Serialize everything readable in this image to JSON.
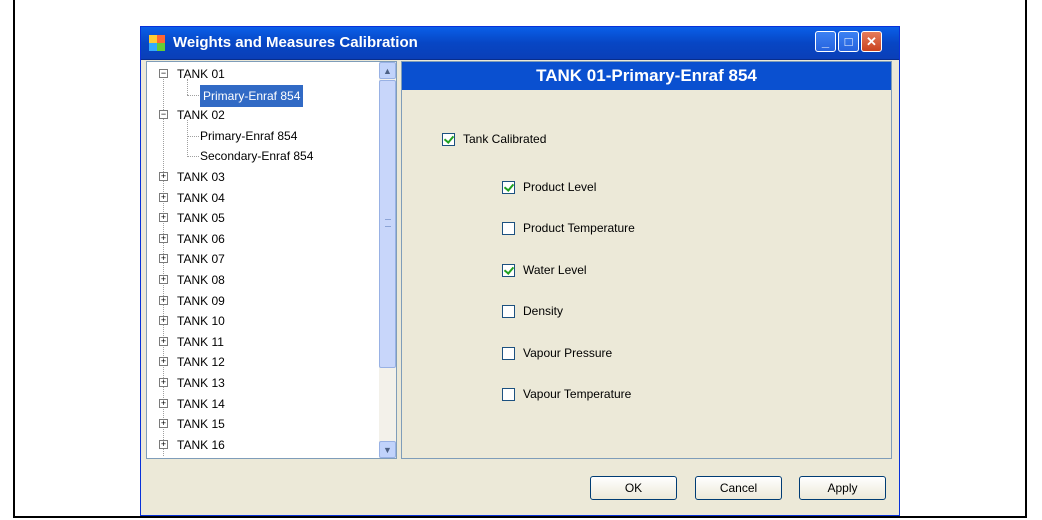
{
  "window": {
    "title": "Weights and Measures Calibration",
    "controls": {
      "minimize": "_",
      "maximize": "□",
      "close": "✕"
    }
  },
  "tree": {
    "items": [
      {
        "label": "TANK 01",
        "expanded": true,
        "children": [
          {
            "label": "Primary-Enraf 854",
            "selected": true
          }
        ]
      },
      {
        "label": "TANK 02",
        "expanded": true,
        "children": [
          {
            "label": "Primary-Enraf 854"
          },
          {
            "label": "Secondary-Enraf 854"
          }
        ]
      },
      {
        "label": "TANK 03",
        "expanded": false
      },
      {
        "label": "TANK 04",
        "expanded": false
      },
      {
        "label": "TANK 05",
        "expanded": false
      },
      {
        "label": "TANK 06",
        "expanded": false
      },
      {
        "label": "TANK 07",
        "expanded": false
      },
      {
        "label": "TANK 08",
        "expanded": false
      },
      {
        "label": "TANK 09",
        "expanded": false
      },
      {
        "label": "TANK 10",
        "expanded": false
      },
      {
        "label": "TANK 11",
        "expanded": false
      },
      {
        "label": "TANK 12",
        "expanded": false
      },
      {
        "label": "TANK 13",
        "expanded": false
      },
      {
        "label": "TANK 14",
        "expanded": false
      },
      {
        "label": "TANK 15",
        "expanded": false
      },
      {
        "label": "TANK 16",
        "expanded": false
      }
    ]
  },
  "panel": {
    "header": "TANK 01-Primary-Enraf 854",
    "tank_calibrated": {
      "label": "Tank Calibrated",
      "checked": true
    },
    "options": [
      {
        "label": "Product Level",
        "checked": true
      },
      {
        "label": "Product Temperature",
        "checked": false
      },
      {
        "label": "Water Level",
        "checked": true
      },
      {
        "label": "Density",
        "checked": false
      },
      {
        "label": "Vapour Pressure",
        "checked": false
      },
      {
        "label": "Vapour Temperature",
        "checked": false
      }
    ]
  },
  "buttons": {
    "ok": "OK",
    "cancel": "Cancel",
    "apply": "Apply"
  }
}
